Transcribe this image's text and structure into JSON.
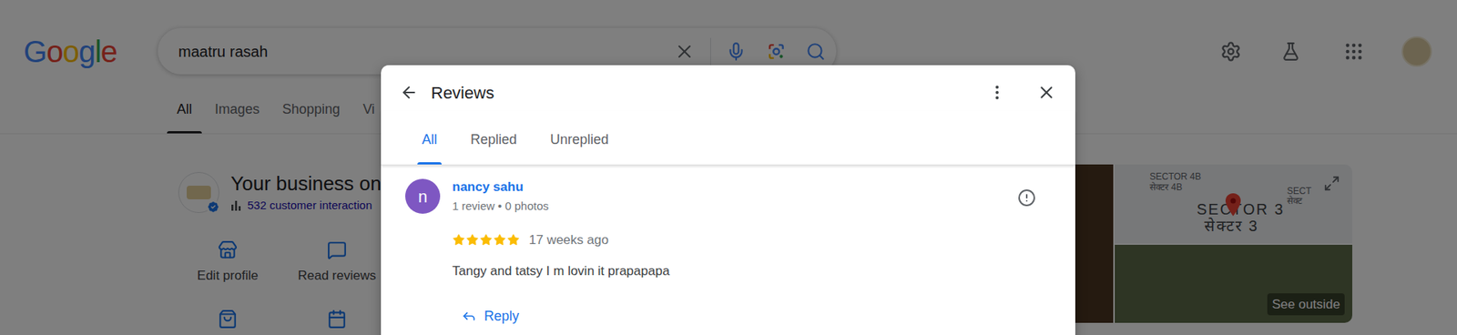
{
  "logo": "Google",
  "search": {
    "query": "maatru rasah"
  },
  "tabs": [
    {
      "label": "All",
      "selected": true
    },
    {
      "label": "Images",
      "selected": false
    },
    {
      "label": "Shopping",
      "selected": false
    },
    {
      "label": "Vi",
      "selected": false
    }
  ],
  "business": {
    "title": "Your business on",
    "interactions": "532 customer interaction",
    "verified": true,
    "actions": [
      {
        "label": "Edit profile"
      },
      {
        "label": "Read reviews"
      }
    ]
  },
  "map": {
    "labels": [
      {
        "text": "SECTOR 4B",
        "kind": "small"
      },
      {
        "text": "सेक्टर 4B",
        "kind": "small"
      },
      {
        "text": "SECTOR 3",
        "kind": "large"
      },
      {
        "text": "सेक्टर 3",
        "kind": "large"
      },
      {
        "text": "SECT",
        "kind": "small"
      },
      {
        "text": "सेक्ट",
        "kind": "small"
      }
    ]
  },
  "photos": {
    "see_outside": "See outside"
  },
  "dialog": {
    "title": "Reviews",
    "tabs": [
      {
        "label": "All",
        "selected": true
      },
      {
        "label": "Replied",
        "selected": false
      },
      {
        "label": "Unreplied",
        "selected": false
      }
    ],
    "reviews": [
      {
        "author": "nancy sahu",
        "initial": "n",
        "meta": "1 review • 0 photos",
        "stars": 5,
        "time": "17 weeks ago",
        "text": "Tangy and tatsy I m lovin it prapapapa",
        "reply": "Reply",
        "color": "#7e57c2"
      }
    ]
  }
}
